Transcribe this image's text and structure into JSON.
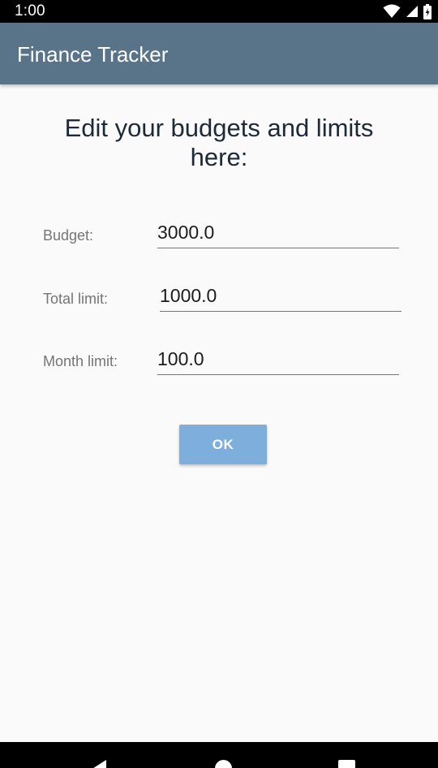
{
  "status_bar": {
    "time": "1:00",
    "icons": [
      "wifi-icon",
      "signal-icon",
      "battery-icon"
    ]
  },
  "app_bar": {
    "title": "Finance Tracker",
    "color": "#597389"
  },
  "main": {
    "heading_line1": "Edit your budgets and limits",
    "heading_line2": "here:",
    "fields": [
      {
        "label": "Budget:",
        "value": "3000.0"
      },
      {
        "label": "Total limit:",
        "value": "1000.0"
      },
      {
        "label": "Month limit:",
        "value": "100.0"
      }
    ],
    "ok_label": "OK",
    "ok_color": "#7eaedb"
  },
  "nav_bar": {
    "icons": [
      "back-icon",
      "home-icon",
      "recents-icon"
    ]
  }
}
